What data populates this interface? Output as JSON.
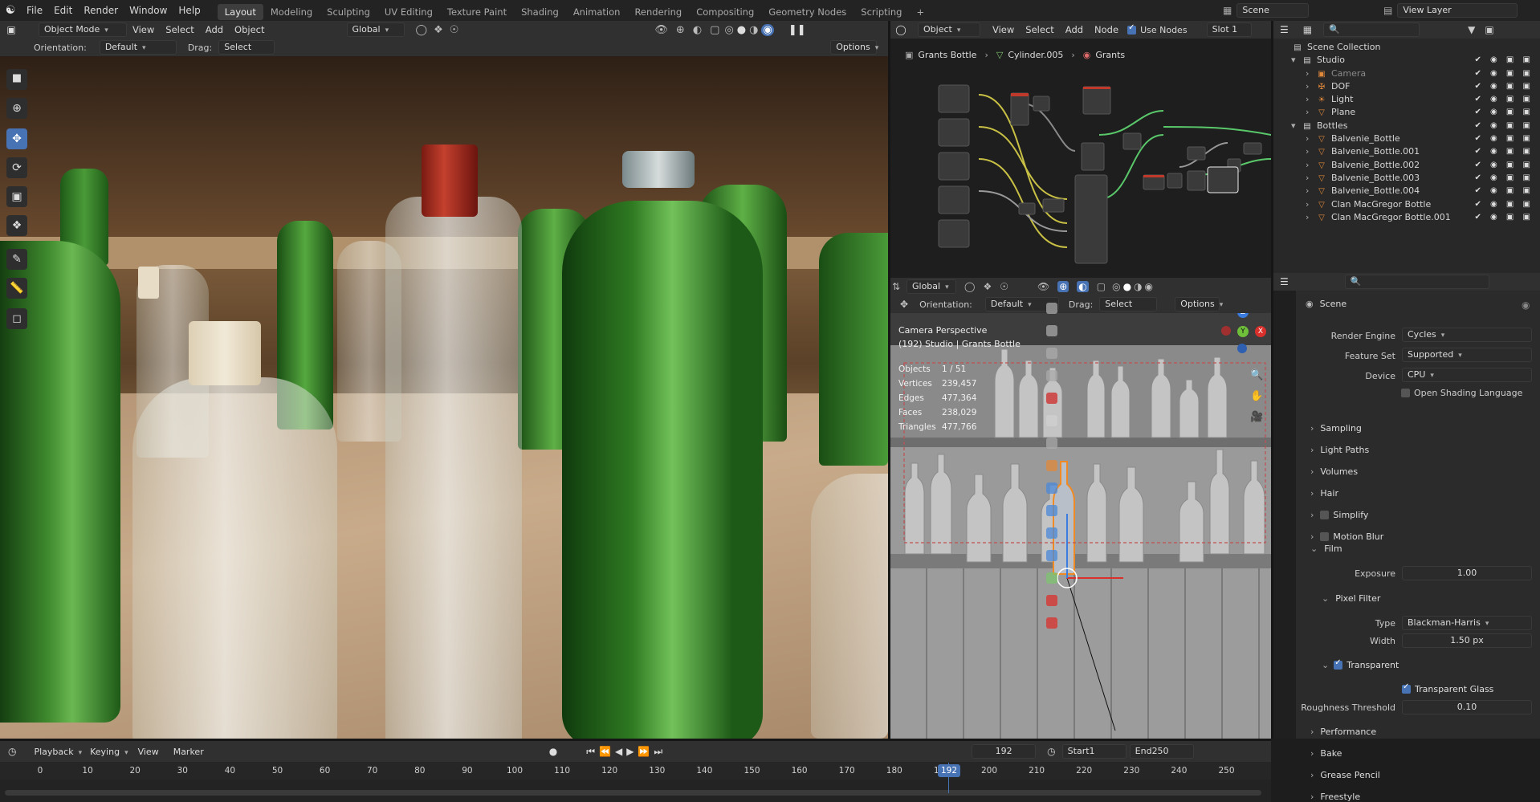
{
  "menu": [
    "File",
    "Edit",
    "Render",
    "Window",
    "Help"
  ],
  "workspaces": [
    "Layout",
    "Modeling",
    "Sculpting",
    "UV Editing",
    "Texture Paint",
    "Shading",
    "Animation",
    "Rendering",
    "Compositing",
    "Geometry Nodes",
    "Scripting"
  ],
  "active_workspace": "Layout",
  "add_workspace": "+",
  "scene": "Scene",
  "view_layer": "View Layer",
  "viewport_header": {
    "mode": "Object Mode",
    "menus": [
      "View",
      "Select",
      "Add",
      "Object"
    ],
    "transform": "Global"
  },
  "viewport_tool_header": {
    "orientation_label": "Orientation:",
    "orientation": "Default",
    "drag_label": "Drag:",
    "drag": "Select Box",
    "options": "Options"
  },
  "node_header": {
    "type": "Object",
    "menus": [
      "View",
      "Select",
      "Add",
      "Node"
    ],
    "use_nodes": "Use Nodes",
    "slot": "Slot 1"
  },
  "node_breadcrumb": [
    "Grants Bottle",
    "Cylinder.005",
    "Grants"
  ],
  "viewport2_header": {
    "transform": "Global",
    "orientation_label": "Orientation:",
    "orientation": "Default",
    "drag_label": "Drag:",
    "drag": "Select Box",
    "options": "Options"
  },
  "viewport2_overlay": {
    "title": "Camera Perspective",
    "subtitle": "(192) Studio | Grants Bottle",
    "stats": [
      {
        "k": "Objects",
        "v": "1 / 51"
      },
      {
        "k": "Vertices",
        "v": "239,457"
      },
      {
        "k": "Edges",
        "v": "477,364"
      },
      {
        "k": "Faces",
        "v": "238,029"
      },
      {
        "k": "Triangles",
        "v": "477,766"
      }
    ],
    "gizmo": {
      "z": "Z",
      "y": "Y",
      "x": "X"
    }
  },
  "outliner": {
    "root": "Scene Collection",
    "items": [
      {
        "name": "Studio",
        "type": "collection",
        "level": 0
      },
      {
        "name": "Camera",
        "type": "camera",
        "level": 1
      },
      {
        "name": "DOF",
        "type": "empty",
        "level": 1
      },
      {
        "name": "Light",
        "type": "light",
        "level": 1
      },
      {
        "name": "Plane",
        "type": "mesh",
        "level": 1
      },
      {
        "name": "Bottles",
        "type": "collection",
        "level": 0
      },
      {
        "name": "Balvenie_Bottle",
        "type": "mesh",
        "level": 1
      },
      {
        "name": "Balvenie_Bottle.001",
        "type": "mesh",
        "level": 1
      },
      {
        "name": "Balvenie_Bottle.002",
        "type": "mesh",
        "level": 1
      },
      {
        "name": "Balvenie_Bottle.003",
        "type": "mesh",
        "level": 1
      },
      {
        "name": "Balvenie_Bottle.004",
        "type": "mesh",
        "level": 1
      },
      {
        "name": "Clan MacGregor Bottle",
        "type": "mesh",
        "level": 1
      },
      {
        "name": "Clan MacGregor Bottle.001",
        "type": "mesh",
        "level": 1
      }
    ]
  },
  "properties": {
    "context": "Scene",
    "render_engine_label": "Render Engine",
    "render_engine": "Cycles",
    "feature_set_label": "Feature Set",
    "feature_set": "Supported",
    "device_label": "Device",
    "device": "CPU",
    "osl": "Open Shading Language",
    "panels": [
      "Sampling",
      "Light Paths",
      "Volumes",
      "Hair",
      "Simplify",
      "Motion Blur"
    ],
    "film": "Film",
    "exposure_label": "Exposure",
    "exposure": "1.00",
    "pixel_filter": "Pixel Filter",
    "type_label": "Type",
    "type": "Blackman-Harris",
    "width_label": "Width",
    "width": "1.50 px",
    "transparent": "Transparent",
    "transparent_glass": "Transparent Glass",
    "roughness_label": "Roughness Threshold",
    "roughness": "0.10",
    "panels_after": [
      "Performance",
      "Bake",
      "Grease Pencil",
      "Freestyle"
    ]
  },
  "timeline": {
    "menus": [
      "Playback",
      "Keying",
      "View",
      "Marker"
    ],
    "current": "192",
    "start_label": "Start",
    "start": "1",
    "end_label": "End",
    "end": "250",
    "ticks": [
      "0",
      "10",
      "20",
      "30",
      "40",
      "50",
      "60",
      "70",
      "80",
      "90",
      "100",
      "110",
      "120",
      "130",
      "140",
      "150",
      "160",
      "170",
      "180",
      "190",
      "200",
      "210",
      "220",
      "230",
      "240",
      "250"
    ],
    "playhead": "192"
  }
}
